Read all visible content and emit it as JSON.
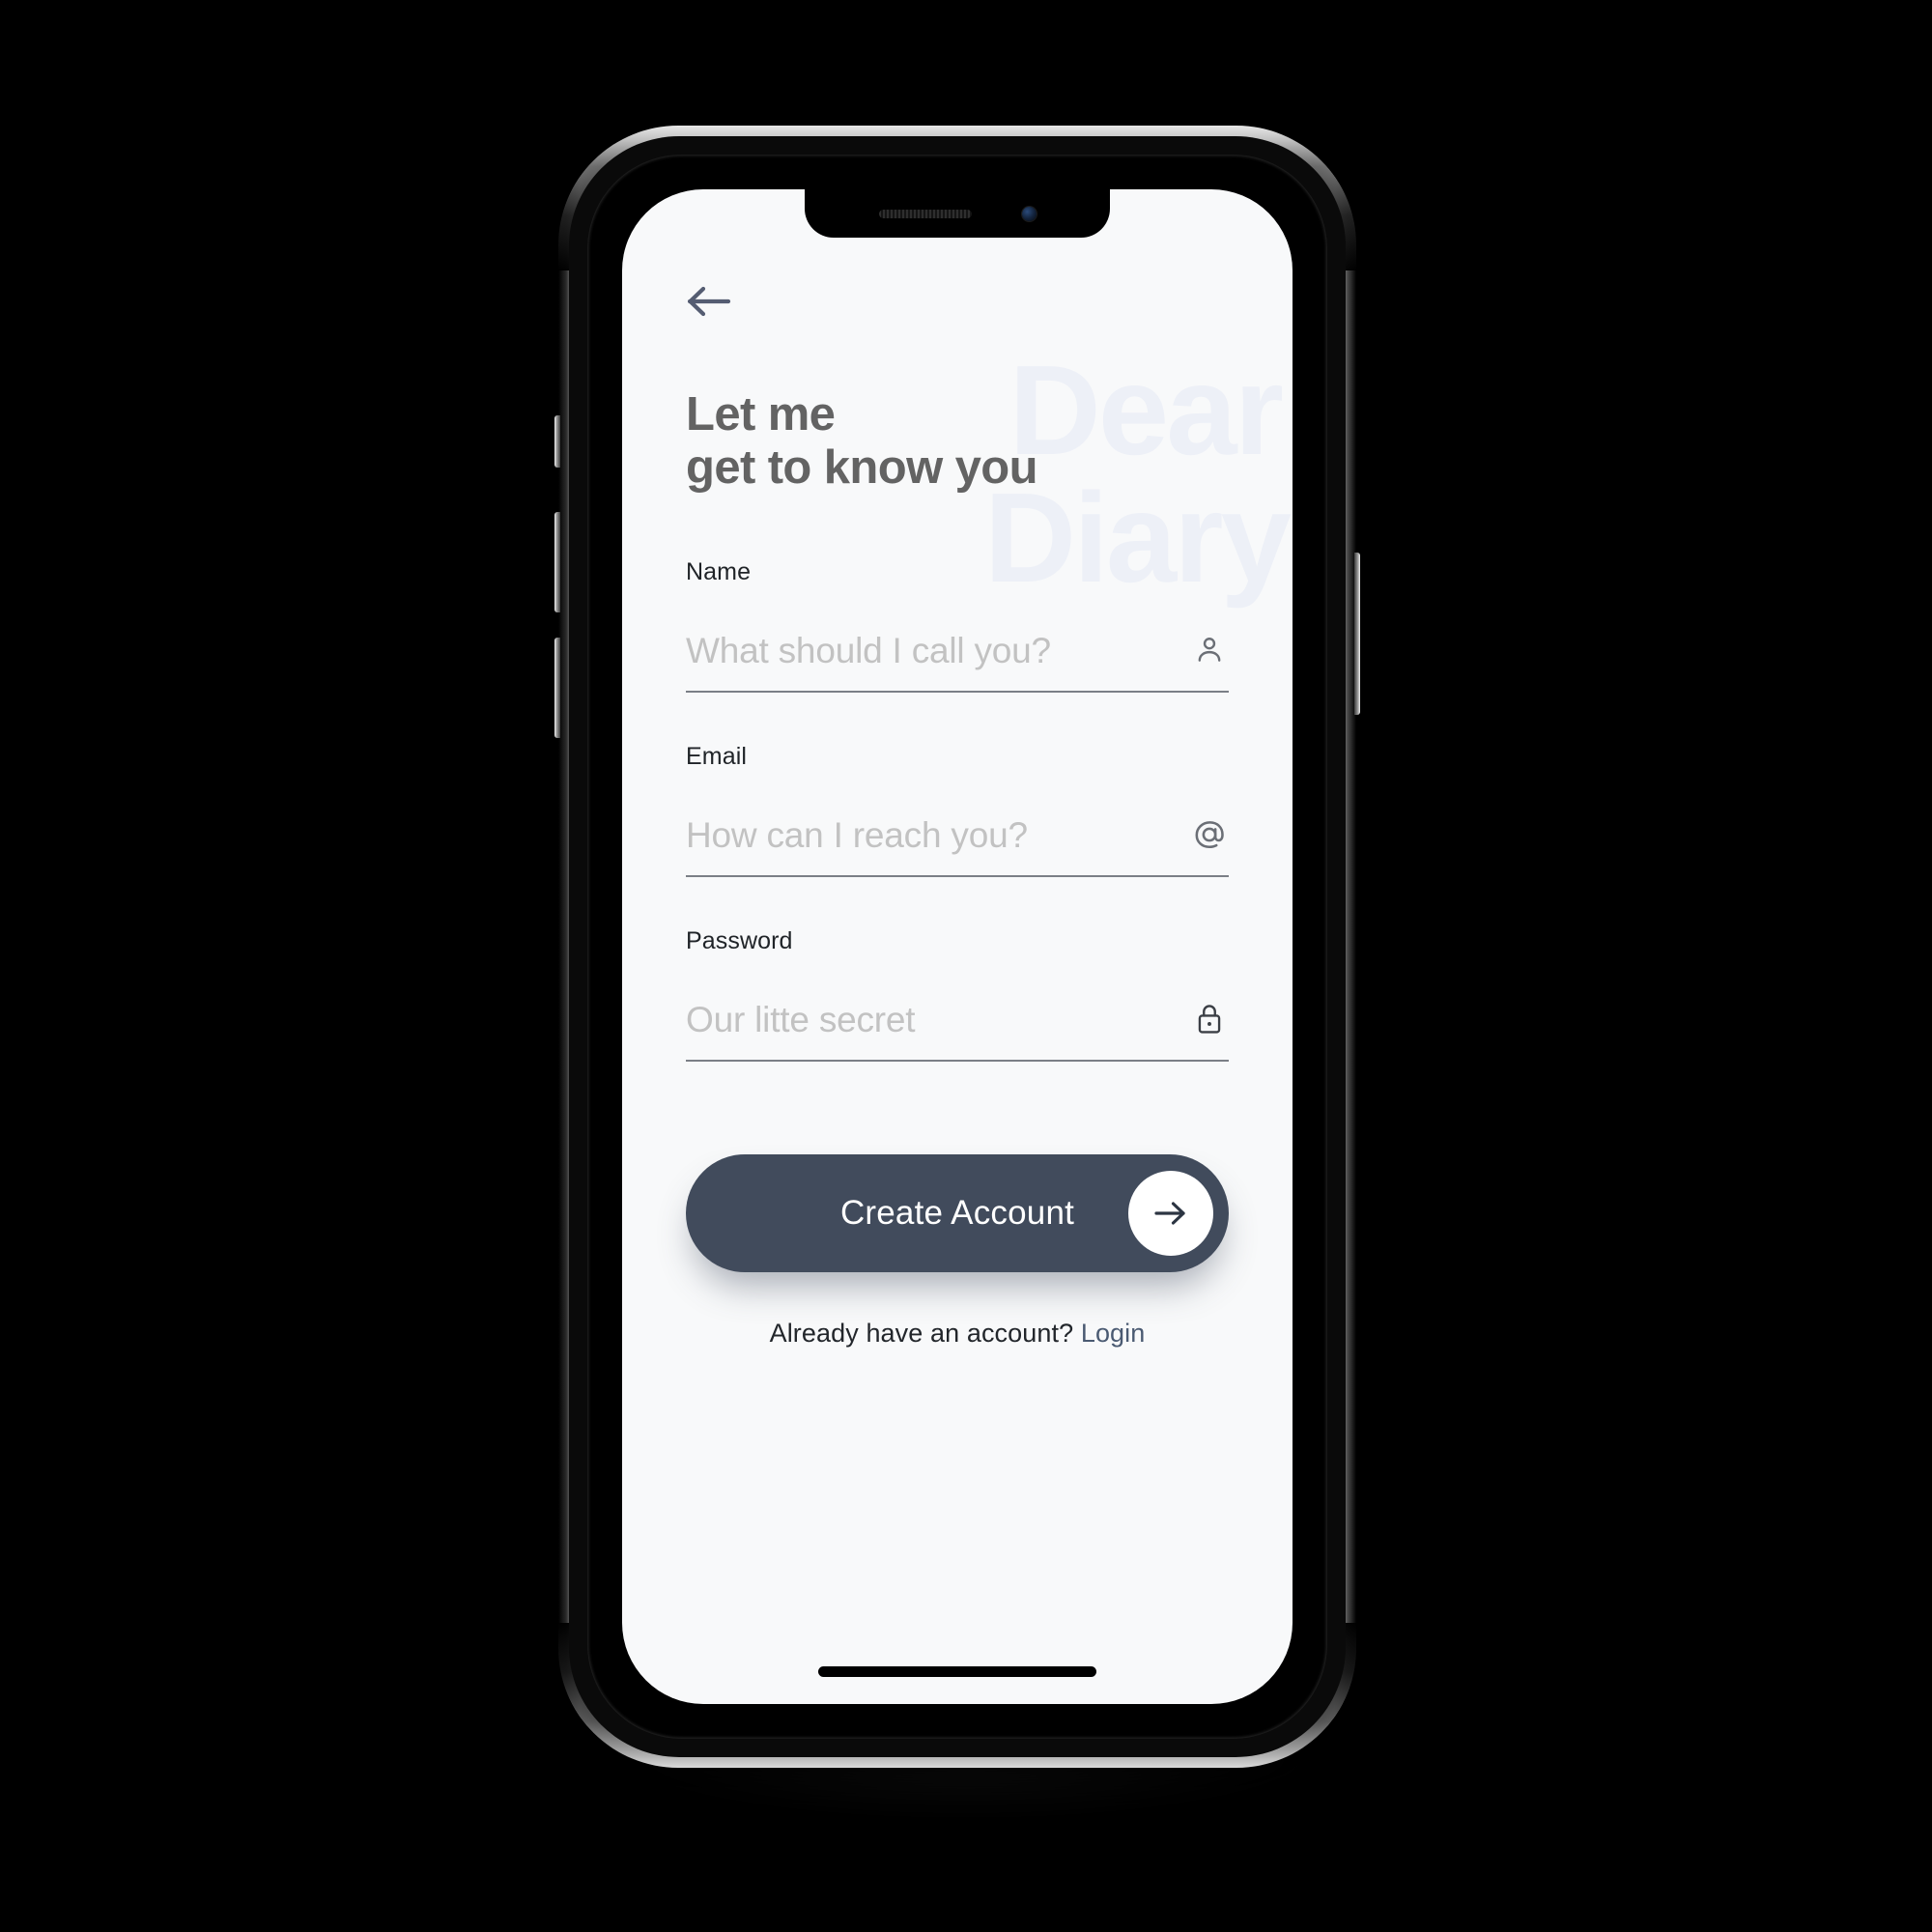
{
  "screen": {
    "background_color": "#f8f9fa",
    "watermark": {
      "line1": "Dear",
      "line2": "Diary",
      "color": "#edf0f7"
    },
    "nav": {
      "back_icon": "arrow-left-icon",
      "back_icon_color": "#555d72"
    },
    "headline": {
      "line1": "Let me",
      "line2": "get to know you",
      "color": "#636363"
    },
    "form": {
      "fields": [
        {
          "label": "Name",
          "placeholder": "What should I call you?",
          "value": "",
          "icon": "person-icon"
        },
        {
          "label": "Email",
          "placeholder": "How can I reach you?",
          "value": "",
          "icon": "at-sign-icon"
        },
        {
          "label": "Password",
          "placeholder": "Our litte secret",
          "value": "",
          "icon": "lock-icon"
        }
      ],
      "underline_color": "#7b7f86",
      "placeholder_color": "#c2c2c2"
    },
    "primary_action": {
      "label": "Create Account",
      "icon": "arrow-right-icon",
      "background_color": "#414b5c",
      "text_color": "#ffffff"
    },
    "footer": {
      "prompt": "Already have an account?",
      "link_label": "Login",
      "link_color": "#4a5a72"
    }
  },
  "device": {
    "notch": {
      "speaker": "speaker-grille",
      "camera": "front-camera"
    },
    "home_indicator": "home-indicator",
    "buttons": {
      "mute": "silence-switch",
      "volume_up": "volume-up-button",
      "volume_down": "volume-down-button",
      "power": "power-button"
    }
  }
}
